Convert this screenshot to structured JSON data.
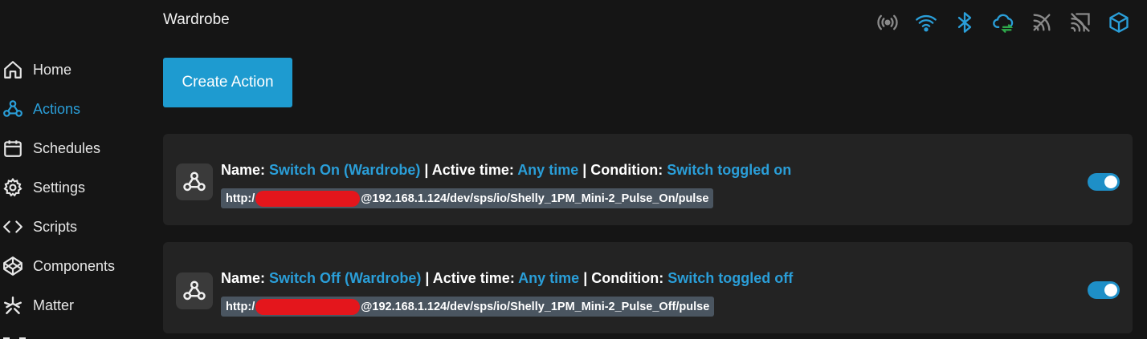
{
  "header": {
    "title": "Wardrobe",
    "status_icons": [
      "radio-icon",
      "wifi-icon",
      "bluetooth-icon",
      "cloud-sync-icon",
      "rss-icon",
      "mqtt-off-icon",
      "cube-icon"
    ]
  },
  "sidebar": {
    "items": [
      {
        "label": "Home",
        "icon": "home-icon"
      },
      {
        "label": "Actions",
        "icon": "webhook-icon",
        "active": true
      },
      {
        "label": "Schedules",
        "icon": "calendar-icon"
      },
      {
        "label": "Settings",
        "icon": "gear-icon"
      },
      {
        "label": "Scripts",
        "icon": "code-icon"
      },
      {
        "label": "Components",
        "icon": "codepen-icon"
      },
      {
        "label": "Matter",
        "icon": "matter-icon"
      }
    ]
  },
  "main": {
    "create_label": "Create Action",
    "labels": {
      "name": "Name:",
      "active_time": "Active time:",
      "condition": "Condition:",
      "sep": "|"
    },
    "actions": [
      {
        "name": "Switch On (Wardrobe)",
        "active_time": "Any time",
        "condition": "Switch toggled on",
        "url_prefix": "http:/",
        "url_suffix": "@192.168.1.124/dev/sps/io/Shelly_1PM_Mini-2_Pulse_On/pulse",
        "enabled": true
      },
      {
        "name": "Switch Off (Wardrobe)",
        "active_time": "Any time",
        "condition": "Switch toggled off",
        "url_prefix": "http:/",
        "url_suffix": "@192.168.1.124/dev/sps/io/Shelly_1PM_Mini-2_Pulse_Off/pulse",
        "enabled": true
      }
    ]
  },
  "colors": {
    "accent": "#2a9ed8",
    "button": "#1e9bd0",
    "background": "#151515",
    "card": "#232323",
    "redaction": "#e4161c"
  }
}
